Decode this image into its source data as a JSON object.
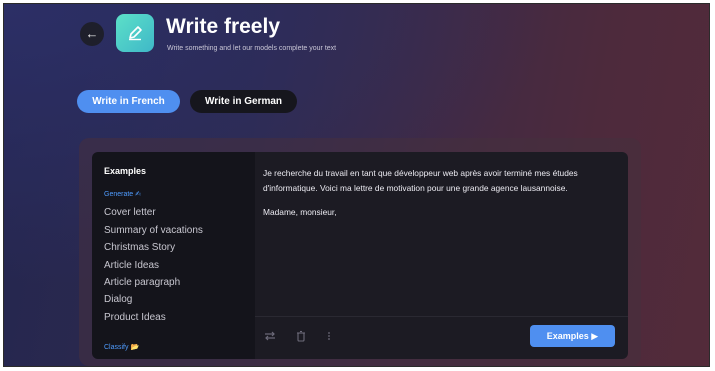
{
  "header": {
    "back_icon": "arrow-left-icon",
    "app_icon": "pen-icon",
    "title": "Write freely",
    "subtitle": "Write something and let our models complete your text"
  },
  "tabs": [
    {
      "label": "Write in French",
      "active": true
    },
    {
      "label": "Write in German",
      "active": false
    }
  ],
  "examples_panel": {
    "heading": "Examples",
    "generate_label": "Generate ✍",
    "items": [
      "Cover letter",
      "Summary of vacations",
      "Christmas Story",
      "Article Ideas",
      "Article paragraph",
      "Dialog",
      "Product Ideas"
    ],
    "classify_label": "Classify 📂"
  },
  "editor": {
    "text": "Je recherche du travail en tant que développeur web après avoir terminé mes études d'informatique. Voici ma lettre de motivation pour une grande agence lausannoise.",
    "greeting": "Madame, monsieur,",
    "toolbar_icons": [
      "shuffle-icon",
      "trash-icon",
      "more-vertical-icon"
    ],
    "examples_button": "Examples ▶"
  },
  "colors": {
    "accent": "#4f8ff0",
    "link": "#4f9cff",
    "panel": "#14141b",
    "editor": "#1c1b23"
  }
}
